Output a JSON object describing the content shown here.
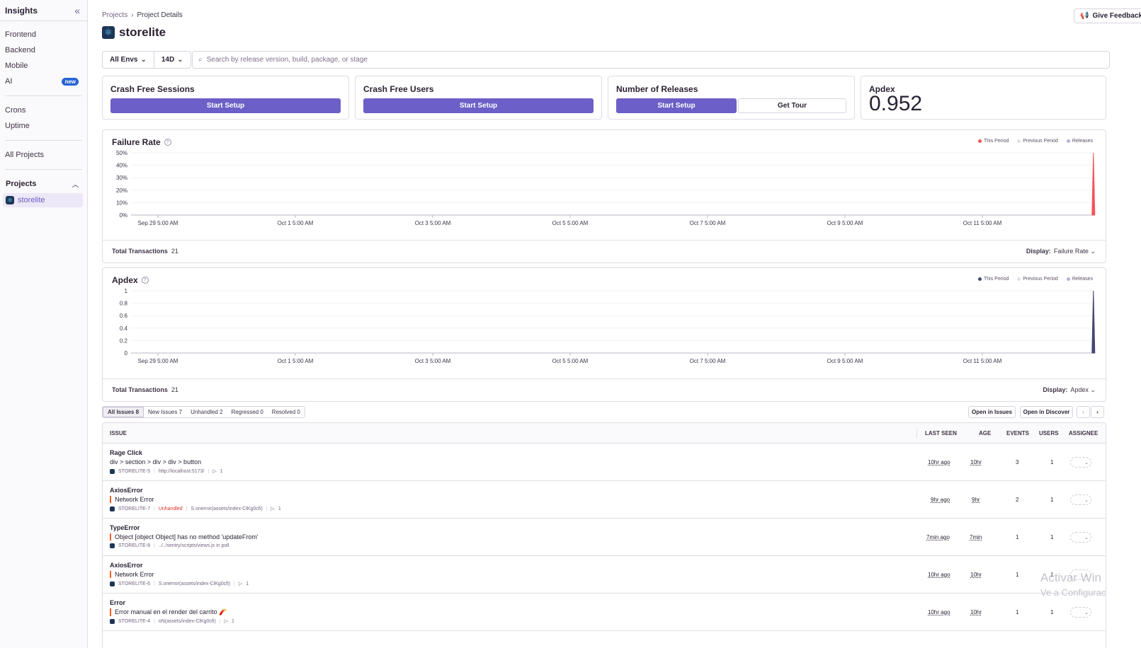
{
  "sidebar": {
    "title": "Insights",
    "group1": [
      {
        "label": "Frontend"
      },
      {
        "label": "Backend"
      },
      {
        "label": "Mobile"
      },
      {
        "label": "AI",
        "badge": "new"
      }
    ],
    "group2": [
      {
        "label": "Crons"
      },
      {
        "label": "Uptime"
      }
    ],
    "all_projects": "All Projects",
    "projects_section": "Projects",
    "project": "storelite"
  },
  "header": {
    "breadcrumb": [
      "Projects",
      "Project Details"
    ],
    "title": "storelite",
    "feedback": "Give Feedback"
  },
  "filters": {
    "env": "All Envs",
    "period": "14D",
    "search_placeholder": "Search by release version, build, package, or stage"
  },
  "cards": [
    {
      "title": "Crash Free Sessions",
      "button": "Start Setup"
    },
    {
      "title": "Crash Free Users",
      "button": "Start Setup"
    },
    {
      "title": "Number of Releases",
      "button": "Start Setup",
      "secondary": "Get Tour"
    },
    {
      "title": "Apdex",
      "value": "0.952"
    }
  ],
  "legend": {
    "this_period": "This Period",
    "previous_period": "Previous Period",
    "releases": "Releases"
  },
  "chart_data": [
    {
      "type": "line",
      "title": "Failure Rate",
      "y_ticks": [
        "50%",
        "40%",
        "30%",
        "20%",
        "10%",
        "0%"
      ],
      "ylim": [
        0,
        50
      ],
      "x_ticks": [
        "Sep 29 5:00 AM",
        "Oct 1 5:00 AM",
        "Oct 3 5:00 AM",
        "Oct 5 5:00 AM",
        "Oct 7 5:00 AM",
        "Oct 9 5:00 AM",
        "Oct 11 5:00 AM"
      ],
      "series": [
        {
          "name": "This Period",
          "color": "#f55459",
          "spike_at": 0.955,
          "value": 50
        }
      ],
      "footer_label": "Total Transactions",
      "footer_value": "21",
      "display_label": "Display:",
      "display_value": "Failure Rate"
    },
    {
      "type": "area",
      "title": "Apdex",
      "y_ticks": [
        "1",
        "0.8",
        "0.6",
        "0.4",
        "0.2",
        "0"
      ],
      "ylim": [
        0,
        1
      ],
      "x_ticks": [
        "Sep 29 5:00 AM",
        "Oct 1 5:00 AM",
        "Oct 3 5:00 AM",
        "Oct 5 5:00 AM",
        "Oct 7 5:00 AM",
        "Oct 9 5:00 AM",
        "Oct 11 5:00 AM"
      ],
      "series": [
        {
          "name": "This Period",
          "color": "#444674",
          "spike_at": 0.955,
          "value": 1
        }
      ],
      "footer_label": "Total Transactions",
      "footer_value": "21",
      "display_label": "Display:",
      "display_value": "Apdex"
    }
  ],
  "issue_tabs": [
    "All Issues 8",
    "New Issues 7",
    "Unhandled 2",
    "Regressed 0",
    "Resolved 0"
  ],
  "issue_actions": {
    "open_issues": "Open in Issues",
    "open_discover": "Open in Discover"
  },
  "issue_columns": {
    "issue": "ISSUE",
    "last_seen": "LAST SEEN",
    "age": "AGE",
    "events": "EVENTS",
    "users": "USERS",
    "assignee": "ASSIGNEE"
  },
  "issues": [
    {
      "title": "Rage Click",
      "message": "div > section > div > div > button",
      "short_id": "STORELITE-5",
      "unhandled": "",
      "culprit": "http://localhost:5173/",
      "replays": "1",
      "last_seen": "10hr ago",
      "age": "10hr",
      "events": "3",
      "users": "1"
    },
    {
      "title": "AxiosError",
      "message": "Network Error",
      "short_id": "STORELITE-7",
      "unhandled": "Unhandled",
      "culprit": "S.onerror(assets/index-ClKg0cfi)",
      "replays": "1",
      "last_seen": "9hr ago",
      "age": "9hr",
      "events": "2",
      "users": "1"
    },
    {
      "title": "TypeError",
      "message": "Object [object Object] has no method 'updateFrom'",
      "short_id": "STORELITE-8",
      "unhandled": "",
      "culprit": "../../sentry/scripts/views.js in poll",
      "replays": "",
      "last_seen": "7min ago",
      "age": "7min",
      "events": "1",
      "users": "1"
    },
    {
      "title": "AxiosError",
      "message": "Network Error",
      "short_id": "STORELITE-6",
      "unhandled": "",
      "culprit": "S.onerror(assets/index-ClKg0cfi)",
      "replays": "1",
      "last_seen": "10hr ago",
      "age": "10hr",
      "events": "1",
      "users": "1"
    },
    {
      "title": "Error",
      "message": "Error manual en el render del carrito 🧨",
      "short_id": "STORELITE-4",
      "unhandled": "",
      "culprit": "oN(assets/index-ClKg0cfi)",
      "replays": "1",
      "last_seen": "10hr ago",
      "age": "10hr",
      "events": "1",
      "users": "1"
    }
  ],
  "watermark": {
    "line1": "Activar Win",
    "line2": "Ve a Configurac"
  }
}
